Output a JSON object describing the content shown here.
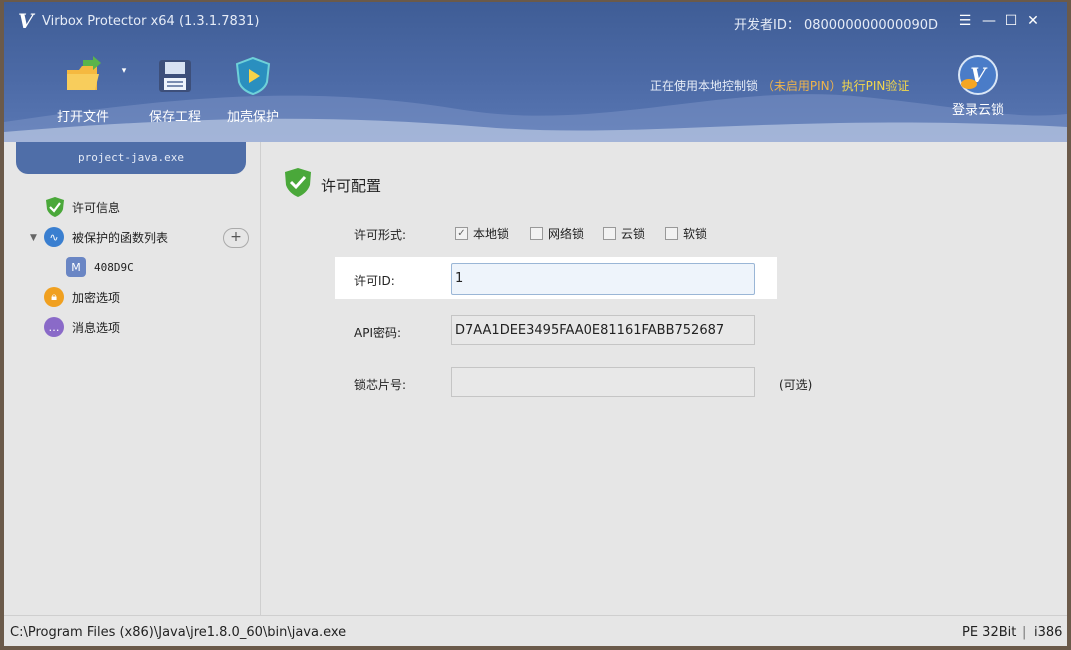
{
  "window": {
    "title": "Virbox Protector x64  (1.3.1.7831)",
    "developer_id": "开发者ID： 080000000000090D",
    "controls": [
      "menu-icon",
      "minimize-icon",
      "maximize-icon",
      "close-icon"
    ]
  },
  "toolbar": {
    "open_file": "打开文件",
    "save_project": "保存工程",
    "add_shell": "加壳保护"
  },
  "lock_status": {
    "prefix": "正在使用本地控制锁",
    "pin_state": "（未启用PIN）",
    "verify_link": "执行PIN验证",
    "cloud_login": "登录云锁"
  },
  "sidebar": {
    "project_name": "project-java.exe",
    "items": [
      {
        "label": "许可信息",
        "icon": "shield-check-icon"
      },
      {
        "label": "被保护的函数列表",
        "icon": "waveform-icon"
      },
      {
        "label": "408D9C",
        "icon": "method-m-icon"
      },
      {
        "label": "加密选项",
        "icon": "lock-icon"
      },
      {
        "label": "消息选项",
        "icon": "chat-icon"
      }
    ]
  },
  "license_config": {
    "title": "许可配置",
    "form_label": "许可形式:",
    "types": [
      {
        "label": "本地锁",
        "checked": true
      },
      {
        "label": "网络锁",
        "checked": false
      },
      {
        "label": "云锁",
        "checked": false
      },
      {
        "label": "软锁",
        "checked": false
      }
    ],
    "license_id_label": "许可ID:",
    "license_id_value": "1",
    "api_key_label": "API密码:",
    "api_key_value": "D7AA1DEE3495FAA0E81161FABB752687",
    "chip_label": "锁芯片号:",
    "chip_value": "",
    "chip_hint": "(可选)"
  },
  "statusbar": {
    "path": "C:\\Program Files (x86)\\Java\\jre1.8.0_60\\bin\\java.exe",
    "pe": "PE 32Bit",
    "separator": "|",
    "arch": "i386"
  },
  "colors": {
    "header": "#4c6aa6",
    "pin_orange": "#f0b44a",
    "verify_yellow": "#f3d74b",
    "shield_green": "#4aa83a"
  }
}
